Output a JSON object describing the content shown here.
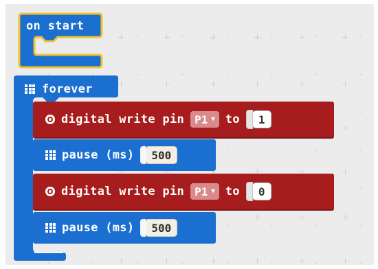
{
  "blocks": {
    "on_start": {
      "label": "on start"
    },
    "forever": {
      "label": "forever"
    },
    "statements": [
      {
        "kind": "digital_write",
        "label": "digital write pin",
        "pin": "P1",
        "to_label": "to",
        "value": "1"
      },
      {
        "kind": "pause",
        "label": "pause (ms)",
        "value": "500"
      },
      {
        "kind": "digital_write",
        "label": "digital write pin",
        "pin": "P1",
        "to_label": "to",
        "value": "0"
      },
      {
        "kind": "pause",
        "label": "pause (ms)",
        "value": "500"
      }
    ]
  },
  "colors": {
    "on_start": "#1b6fd0",
    "on_start_outline": "#f2c12e",
    "forever": "#1b6fd0",
    "pins": "#a71d1d",
    "workspace": "#ececec"
  },
  "icons": {
    "forever": "grid-icon",
    "pause": "grid-icon",
    "digital_write": "target-icon",
    "dropdown": "caret-down-icon"
  }
}
